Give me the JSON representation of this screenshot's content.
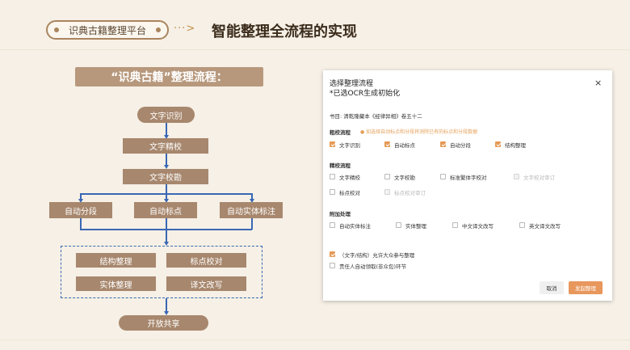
{
  "header": {
    "platform_label": "识典古籍整理平台",
    "arrow": "···>",
    "title": "智能整理全流程的实现"
  },
  "diagram": {
    "banner": "“识典古籍”整理流程：",
    "start": "文字识别",
    "step2": "文字精校",
    "step3": "文字校勘",
    "branches": [
      "自动分段",
      "自动标点",
      "自动实体标注"
    ],
    "group": [
      "结构整理",
      "标点校对",
      "实体整理",
      "译文改写"
    ],
    "end": "开放共享"
  },
  "dialog": {
    "title": "选择整理流程",
    "subtitle": "*已选OCR生成初始化",
    "close": "×",
    "book": "书目: 清乾隆藏本《经律异相》卷五十二",
    "rough": {
      "label": "粗校流程",
      "hint": "如选择自动标点和分段将消除已有的标点和分段数据",
      "items": [
        {
          "label": "文字识别",
          "state": "on"
        },
        {
          "label": "自动标点",
          "state": "on"
        },
        {
          "label": "自动分段",
          "state": "on"
        },
        {
          "label": "结构整理",
          "state": "on"
        }
      ]
    },
    "fine": {
      "label": "精校流程",
      "row1": [
        {
          "label": "文字精校",
          "state": "off"
        },
        {
          "label": "文字校勘",
          "state": "off"
        },
        {
          "label": "标准繁体字校对",
          "state": "off"
        },
        {
          "label": "文字校对审订",
          "state": "disabled"
        }
      ],
      "row2": [
        {
          "label": "标点校对",
          "state": "off"
        },
        {
          "label": "标点校对审订",
          "state": "disabled"
        }
      ]
    },
    "extra": {
      "label": "附加处理",
      "items": [
        {
          "label": "自动实体标注",
          "state": "off"
        },
        {
          "label": "实体整理",
          "state": "off"
        },
        {
          "label": "中文译文改写",
          "state": "off"
        },
        {
          "label": "英文译文改写",
          "state": "off"
        }
      ]
    },
    "options": [
      {
        "label": "（文字/结构）允许大众参与整理",
        "state": "on"
      },
      {
        "label": "责任人自动领取(非众包)环节",
        "state": "off"
      }
    ],
    "cancel": "取消",
    "start": "发起整理"
  }
}
